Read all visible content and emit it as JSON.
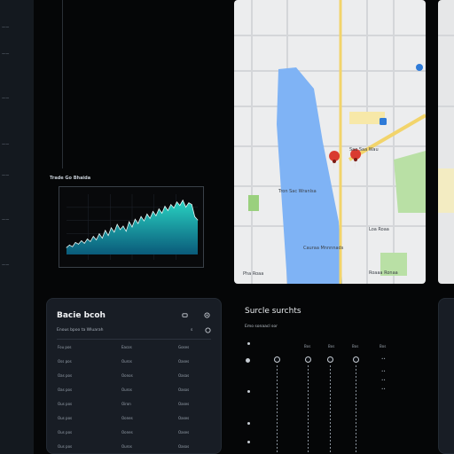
{
  "nav": {
    "labels": [
      "",
      "",
      "",
      "",
      "",
      "",
      ""
    ]
  },
  "chart": {
    "title": "Trade Go Bhaida"
  },
  "chart_data": {
    "type": "area",
    "title": "Trade Go Bhaida",
    "xlabel": "",
    "ylabel": "",
    "grid": true,
    "values": [
      8,
      11,
      9,
      14,
      12,
      16,
      13,
      18,
      15,
      21,
      17,
      24,
      19,
      28,
      22,
      31,
      26,
      35,
      29,
      33,
      27,
      38,
      32,
      41,
      36,
      44,
      39,
      47,
      42,
      50,
      45,
      53,
      48,
      56,
      51,
      58,
      54,
      61,
      57,
      63,
      55,
      60,
      58,
      44,
      40
    ]
  },
  "map": {
    "labels": {
      "poi1": "Sao Saa Wau",
      "poi2": "Tron Sac Wranlsa",
      "poi3": "Cauraa Mnnnnads",
      "poi4": "Loa Roaa",
      "poi5": "Roa Roaa",
      "bottom_left": "Pha Roaa",
      "bottom_right": "Roaaa Ronaa"
    },
    "water_color": "#7fb3f5",
    "park_color": "#b9e0a5",
    "pin_color": "#d93b30"
  },
  "card": {
    "title": "Bacie bcoh",
    "subtitle": "Enous bpoo ta Wluarah",
    "sub_value": "s",
    "columns": [
      [
        "Fou pos",
        "Oss pos",
        "Oas pos",
        "Oas pos",
        "Ous pos",
        "Ous pos",
        "Ous pos",
        "Ous pos"
      ],
      [
        "Eacos",
        "Ouros",
        "Oonos",
        "Ouros",
        "Oiron",
        "Oones",
        "Oones",
        "Ouros"
      ],
      [
        "Goses",
        "Oases",
        "Oasas",
        "Oasos",
        "Oases",
        "Oases",
        "Oases",
        "Oasos"
      ]
    ]
  },
  "settings": {
    "title": "Surcle surchts",
    "subtitle": "Emo sonaacl sor",
    "col_heads": [
      "Bos",
      "Bos",
      "Bos",
      "Bos"
    ]
  }
}
